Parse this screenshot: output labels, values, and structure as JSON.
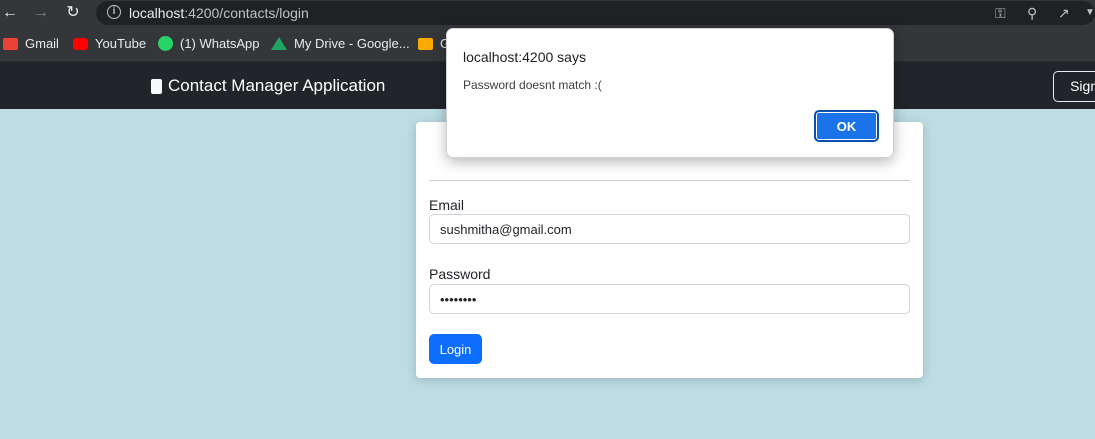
{
  "browser": {
    "url_host": "localhost",
    "url_rest": ":4200/contacts/login",
    "icons": [
      "back-icon",
      "forward-icon",
      "reload-icon",
      "info-icon",
      "key-icon",
      "zoom-icon",
      "share-icon",
      "menu-icon"
    ]
  },
  "bookmarks": [
    {
      "label": "Gmail",
      "icon": "gmail-icon",
      "color": "#ea4335"
    },
    {
      "label": "YouTube",
      "icon": "youtube-icon",
      "color": "#ff0000"
    },
    {
      "label": "(1) WhatsApp",
      "icon": "whatsapp-icon",
      "color": "#25d366"
    },
    {
      "label": "My Drive - Google...",
      "icon": "drive-icon",
      "color": "#fbbc04"
    },
    {
      "label": "G",
      "icon": "classroom-icon",
      "color": "#f9ab00"
    }
  ],
  "app_nav": {
    "brand": "Contact Manager Application",
    "signup_label": "Signu"
  },
  "login_form": {
    "email_label": "Email",
    "email_value": "sushmitha@gmail.com",
    "password_label": "Password",
    "password_value": "sushmith",
    "login_label": "Login"
  },
  "alert": {
    "title": "localhost:4200 says",
    "message": "Password doesnt match :(",
    "ok_label": "OK"
  },
  "colors": {
    "page_background": "#bddce4",
    "navbar": "#212529",
    "primary": "#0d6efd",
    "dialog_button": "#1a73e8"
  }
}
